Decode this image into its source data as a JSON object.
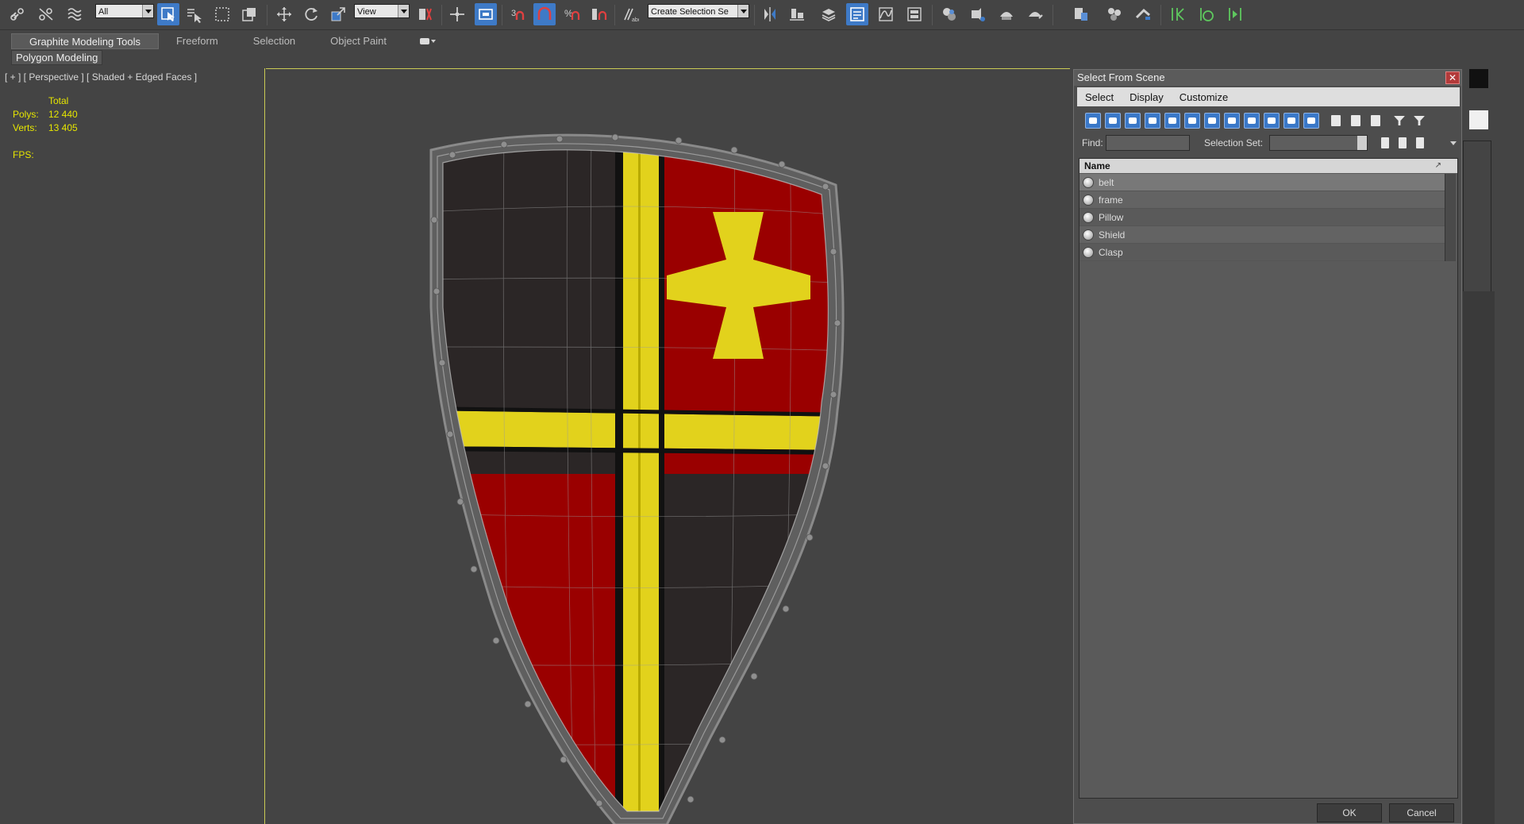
{
  "toolbar": {
    "selection_filter": "All",
    "ref_coord": "View",
    "named_selection": "Create Selection Se"
  },
  "ribbon": {
    "tabs": [
      "Graphite Modeling Tools",
      "Freeform",
      "Selection",
      "Object Paint"
    ],
    "panel_label": "Polygon Modeling"
  },
  "left_viewport": {
    "label": "[ + ] [ Perspective ] [ Shaded + Edged Faces ]",
    "stats_header": "Total",
    "polys_label": "Polys:",
    "polys_value": "12 440",
    "verts_label": "Verts:",
    "verts_value": "13 405",
    "fps_label": "FPS:",
    "stats_color": "#e6e600"
  },
  "shield": {
    "colors": {
      "red": "#9a0000",
      "black": "#2b2626",
      "yellow": "#e2d21c",
      "rim": "#7a7a7a"
    }
  },
  "dialog": {
    "title": "Select From Scene",
    "close_glyph": "✕",
    "menu": [
      "Select",
      "Display",
      "Customize"
    ],
    "find_label": "Find:",
    "selset_label": "Selection Set:",
    "column_name": "Name",
    "sort_glyph": "↗",
    "items": [
      "belt",
      "frame",
      "Pillow",
      "Shield",
      "Clasp"
    ],
    "ok_label": "OK",
    "cancel_label": "Cancel"
  }
}
